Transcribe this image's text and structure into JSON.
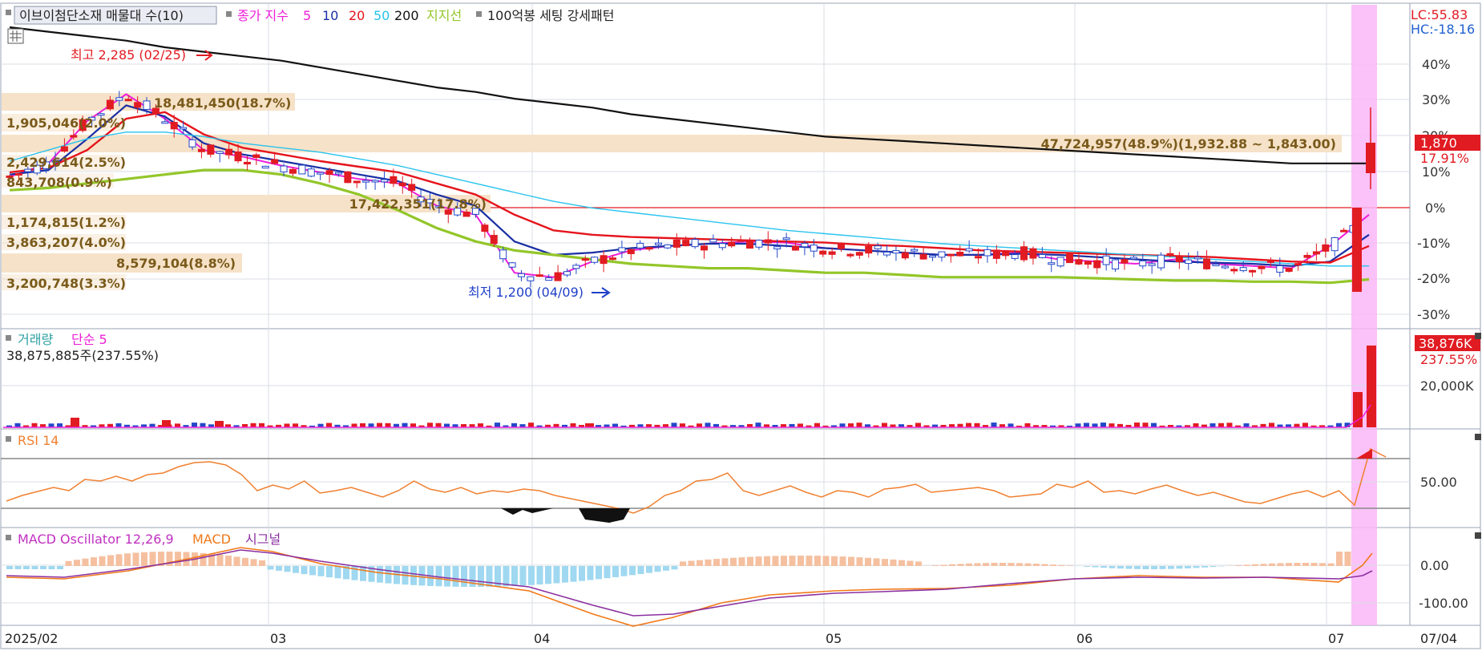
{
  "colors": {
    "up": "#e11b22",
    "down": "#2348c8",
    "ma5": "#ee1fd8",
    "ma10": "#1a2fa4",
    "ma20": "#e5141c",
    "ma50": "#29c3ee",
    "ma200": "#111111",
    "support": "#93c629",
    "band": "#f6e2c8",
    "band_text": "#7a5a1a",
    "highlight": "#f9b7f7",
    "rsi": "#f08030",
    "macd": "#f07818",
    "signal": "#8b2fa0",
    "osc_pos": "#f5c0a0",
    "osc_neg": "#9fd8f0",
    "cur_box": "#e11b22"
  },
  "price_panel": {
    "legend": {
      "stock": "이브이첨단소재 매물대 수(10)",
      "ma_label": "종가 지수",
      "ma_periods": [
        "5",
        "10",
        "20",
        "50",
        "200"
      ],
      "support": "지지선",
      "pattern": "100억봉 세팅 강세패턴"
    },
    "top_right": {
      "lc": "LC:55.83",
      "hc": "HC:-18.16"
    },
    "high_label": "최고 2,285 (02/25)",
    "low_label": "최저 1,200 (04/09)",
    "current_price": "1,870",
    "current_pct": "17.91%",
    "axis_ticks": [
      "40%",
      "30%",
      "20%",
      "10%",
      "0%",
      "-10%",
      "-20%",
      "-30%"
    ],
    "volume_profile": [
      "18,481,450(18.7%)",
      "1,905,046(2.0%)",
      "47,724,957(48.9%)(1,932.88 ~ 1,843.00)",
      "2,429,614(2.5%)",
      "843,708(0.9%)",
      "17,422,351(17.8%)",
      "1,174,815(1.2%)",
      "3,863,207(4.0%)",
      "8,579,104(8.8%)",
      "3,200,748(3.3%)"
    ]
  },
  "volume_panel": {
    "legend_vol": "거래량",
    "legend_ma": "단순 5",
    "summary": "38,875,885주(237.55%)",
    "current_box": "38,876K",
    "current_pct": "237.55%",
    "axis_tick": "20,000K"
  },
  "rsi_panel": {
    "legend": "RSI 14",
    "axis_tick": "50.00"
  },
  "macd_panel": {
    "legend_osc": "MACD Oscillator 12,26,9",
    "legend_macd": "MACD",
    "legend_signal": "시그널",
    "axis_ticks": [
      "0.00",
      "-100.00"
    ]
  },
  "x_axis": {
    "labels": [
      "2025/02",
      "03",
      "04",
      "05",
      "06",
      "07"
    ],
    "right_label": "07/04"
  },
  "chart_data": {
    "type": "candlestick",
    "ylim": [
      1200,
      2285
    ],
    "high": 2285,
    "high_date": "02/25",
    "low": 1200,
    "low_date": "04/09",
    "last_close": 1870,
    "series": [
      {
        "name": "종가 지수 5",
        "values": [
          1730,
          1790,
          1980,
          2100,
          1990,
          1850,
          1820,
          1780,
          1750,
          1720,
          1700,
          1600,
          1560,
          1300,
          1280,
          1350,
          1400,
          1420,
          1430,
          1440,
          1435,
          1410,
          1400,
          1390,
          1380,
          1380,
          1390,
          1360,
          1350,
          1340,
          1360,
          1340,
          1330,
          1320,
          1420,
          1560
        ]
      },
      {
        "name": "종가 지수 10",
        "values": [
          1740,
          1760,
          1900,
          2050,
          2000,
          1880,
          1830,
          1800,
          1770,
          1740,
          1710,
          1650,
          1600,
          1440,
          1380,
          1390,
          1410,
          1420,
          1430,
          1430,
          1420,
          1410,
          1400,
          1390,
          1380,
          1380,
          1385,
          1380,
          1370,
          1360,
          1350,
          1345,
          1340,
          1330,
          1350,
          1470
        ]
      },
      {
        "name": "종가 지수 20",
        "values": [
          1750,
          1770,
          1850,
          1990,
          2020,
          1920,
          1860,
          1830,
          1800,
          1775,
          1750,
          1700,
          1650,
          1560,
          1490,
          1470,
          1460,
          1455,
          1450,
          1445,
          1440,
          1435,
          1425,
          1420,
          1410,
          1400,
          1395,
          1390,
          1385,
          1380,
          1375,
          1370,
          1360,
          1350,
          1345,
          1420
        ]
      },
      {
        "name": "종가 지수 50",
        "values": [
          1800,
          1850,
          1900,
          1930,
          1930,
          1910,
          1880,
          1860,
          1840,
          1810,
          1780,
          1740,
          1700,
          1660,
          1620,
          1590,
          1570,
          1550,
          1530,
          1510,
          1490,
          1475,
          1460,
          1445,
          1430,
          1420,
          1410,
          1400,
          1390,
          1380,
          1370,
          1360,
          1350,
          1340,
          1330,
          1330
        ]
      },
      {
        "name": "종가 지수 200",
        "values": [
          2400,
          2380,
          2360,
          2340,
          2310,
          2290,
          2270,
          2250,
          2220,
          2190,
          2160,
          2130,
          2110,
          2080,
          2060,
          2040,
          2010,
          1990,
          1970,
          1950,
          1930,
          1910,
          1900,
          1890,
          1880,
          1870,
          1860,
          1850,
          1840,
          1830,
          1820,
          1810,
          1800,
          1790,
          1790,
          1790
        ]
      },
      {
        "name": "지지선",
        "values": [
          1670,
          1680,
          1700,
          1720,
          1740,
          1760,
          1760,
          1740,
          1700,
          1650,
          1580,
          1500,
          1440,
          1400,
          1380,
          1360,
          1340,
          1330,
          1320,
          1320,
          1310,
          1300,
          1300,
          1290,
          1280,
          1280,
          1280,
          1280,
          1275,
          1270,
          1265,
          1265,
          1260,
          1260,
          1255,
          1270
        ]
      }
    ]
  }
}
